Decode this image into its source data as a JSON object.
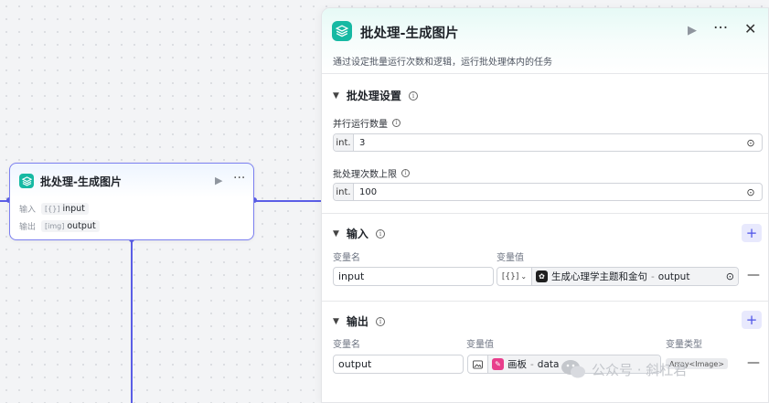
{
  "node": {
    "title": "批处理-生成图片",
    "input_label": "输入",
    "input_param": "input",
    "input_type": "[{}]",
    "output_label": "输出",
    "output_param": "output",
    "output_type": "[img]"
  },
  "panel": {
    "title": "批处理-生成图片",
    "description": "通过设定批量运行次数和逻辑，运行批处理体内的任务",
    "batch_settings": {
      "heading": "批处理设置",
      "parallel_label": "并行运行数量",
      "parallel_type": "int.",
      "parallel_value": "3",
      "max_label": "批处理次数上限",
      "max_type": "int.",
      "max_value": "100"
    },
    "input_section": {
      "heading": "输入",
      "col_name": "变量名",
      "col_value": "变量值",
      "row_name": "input",
      "row_ref_type": "[{}]",
      "row_ref_node": "生成心理学主题和金句",
      "row_ref_sep": "-",
      "row_ref_var": "output"
    },
    "output_section": {
      "heading": "输出",
      "col_name": "变量名",
      "col_value": "变量值",
      "col_type": "变量类型",
      "row_name": "output",
      "row_ref_node": "画板",
      "row_ref_sep": "-",
      "row_ref_var": "data",
      "row_type": "Array<Image>"
    }
  },
  "watermark": {
    "text": "公众号 · 斜杠君"
  },
  "colors": {
    "accent": "#5b5ee6",
    "node_icon": "#16b9a3",
    "plus_bg": "#e8e9fd"
  }
}
